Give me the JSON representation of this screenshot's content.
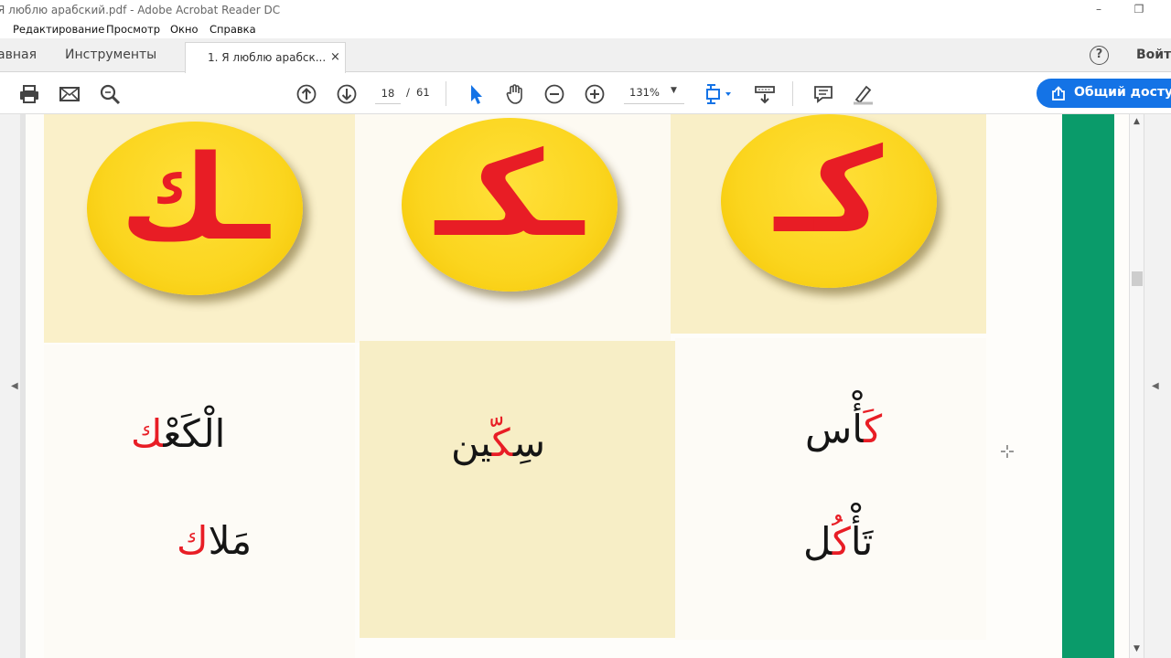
{
  "window": {
    "title": "Я люблю арабский.pdf - Adobe Acrobat Reader DC"
  },
  "menu": {
    "items": [
      "Редактирование",
      "Просмотр",
      "Окно",
      "Справка"
    ]
  },
  "tabs": {
    "home": "авная",
    "tools": "Инструменты",
    "document": "1. Я люблю арабск...",
    "close": "×",
    "help": "?",
    "signin": "Войт"
  },
  "toolbar": {
    "current_page": "18",
    "page_separator": "/",
    "total_pages": "61",
    "zoom": "131%",
    "share_label": "Общий доступ",
    "icons": [
      "print-icon",
      "email-icon",
      "find-icon",
      "page-up-icon",
      "page-down-icon",
      "select-arrow-icon",
      "hand-icon",
      "zoom-out-icon",
      "zoom-in-icon",
      "page-fit-icon",
      "scroll-mode-icon",
      "comment-icon",
      "highlight-icon"
    ]
  },
  "document": {
    "letter_forms": [
      "ـك",
      "ـكـ",
      "كـ"
    ],
    "words": [
      {
        "cell": "left-top",
        "before": "الْكَعْ",
        "highlight": "ك"
      },
      {
        "cell": "middle",
        "before": "سِ",
        "highlight": "كّ",
        "after": "ين"
      },
      {
        "cell": "right-top",
        "highlight": "كَ",
        "after": "أْس"
      },
      {
        "cell": "left-bottom",
        "before": "مَلا",
        "highlight": "ك"
      },
      {
        "cell": "right-bottom",
        "before": "تَأْ",
        "highlight": "كُ",
        "after": "ل"
      }
    ],
    "colors": {
      "highlight": "#e81d25",
      "circle": "#fbd51e",
      "stripe": "#0a9b6a",
      "shaded_cell": "#f9f0c8"
    }
  }
}
